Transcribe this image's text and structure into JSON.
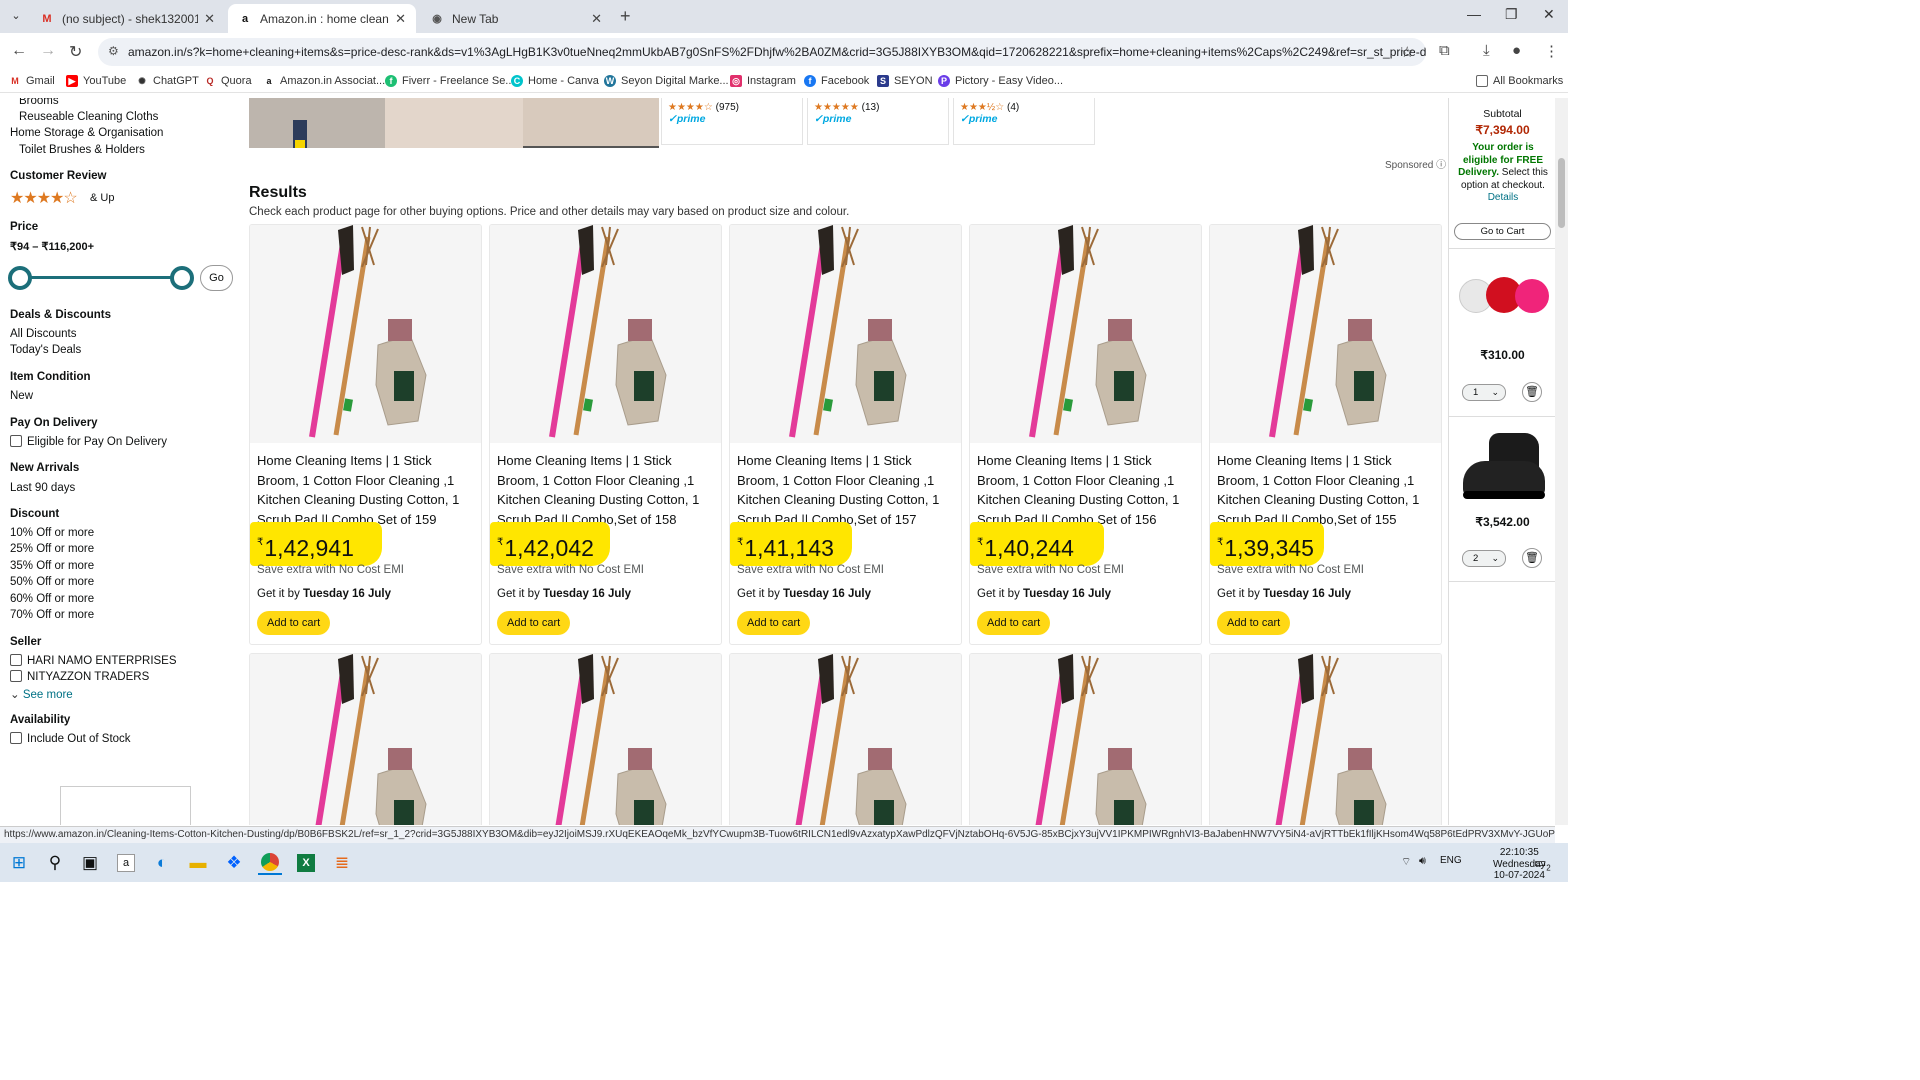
{
  "browser": {
    "tabs": [
      {
        "title": "(no subject) - shek132001@gmail.com",
        "icon": "gmail-icon"
      },
      {
        "title": "Amazon.in : home cleaning items",
        "icon": "amazon-icon"
      },
      {
        "title": "New Tab",
        "icon": "chrome-icon"
      }
    ],
    "url": "amazon.in/s?k=home+cleaning+items&s=price-desc-rank&ds=v1%3AgLHgB1K3v0tueNneq2mmUkbAB7g0SnFS%2FDhjfw%2BA0ZM&crid=3G5J88IXYB3OM&qid=1720628221&sprefix=home+cleaning+items%2Caps%2C249&ref=sr_st_price-desc-ra...",
    "bookmarks": [
      "Gmail",
      "YouTube",
      "ChatGPT",
      "Quora",
      "Amazon.in Associat...",
      "Fiverr - Freelance Se...",
      "Home - Canva",
      "Seyon Digital Marke...",
      "Instagram",
      "Facebook",
      "SEYON",
      "Pictory - Easy Video..."
    ],
    "all_bookmarks": "All Bookmarks",
    "status_url": "https://www.amazon.in/Cleaning-Items-Cotton-Kitchen-Dusting/dp/B0B6FBSK2L/ref=sr_1_2?crid=3G5J88IXYB3OM&dib=eyJ2IjoiMSJ9.rXUqEKEAOqeMk_bzVfYCwupm3B-Tuow6tRILCN1edl9vAzxatypXawPdlzQFVjNztabOHq-6V5JG-85xBCjxY3ujVV1IPKMPIWRgnhVI3-BaJabenHNW7VY5iN4-aVjRTTbEk1fIljKHsom4Wq58P6tEdPRV3XMvY-JGUoPNM_Jm-TTt2l..."
  },
  "sidebar": {
    "top_items": [
      "Brooms",
      "Reuseable Cleaning Cloths",
      "Home Storage & Organisation",
      "Toilet Brushes & Holders"
    ],
    "customer_review": {
      "heading": "Customer Review",
      "stars": 4,
      "suffix": "& Up"
    },
    "price": {
      "heading": "Price",
      "range": "₹94 – ₹116,200+",
      "go": "Go",
      "min_fraction": 0,
      "max_fraction": 1
    },
    "deals": {
      "heading": "Deals & Discounts",
      "items": [
        "All Discounts",
        "Today's Deals"
      ]
    },
    "condition": {
      "heading": "Item Condition",
      "items": [
        "New"
      ]
    },
    "pod": {
      "heading": "Pay On Delivery",
      "items": [
        "Eligible for Pay On Delivery"
      ]
    },
    "arrivals": {
      "heading": "New Arrivals",
      "items": [
        "Last 90 days"
      ]
    },
    "discount": {
      "heading": "Discount",
      "items": [
        "10% Off or more",
        "25% Off or more",
        "35% Off or more",
        "50% Off or more",
        "60% Off or more",
        "70% Off or more"
      ]
    },
    "seller": {
      "heading": "Seller",
      "items": [
        "HARI NAMO ENTERPRISES",
        "NITYAZZON TRADERS"
      ],
      "see_more": "See more"
    },
    "availability": {
      "heading": "Availability",
      "items": [
        "Include Out of Stock"
      ]
    }
  },
  "sponsored_strip": {
    "cards": [
      {
        "rating_count": "(975)",
        "prime": "prime"
      },
      {
        "rating_count": "(13)",
        "prime": "prime"
      },
      {
        "rating_count": "(4)",
        "prime": "prime"
      }
    ],
    "sponsored_label": "Sponsored"
  },
  "results": {
    "heading": "Results",
    "subheading": "Check each product page for other buying options. Price and other details may vary based on product size and colour.",
    "products": [
      {
        "title": "Home Cleaning Items | 1 Stick Broom, 1 Cotton Floor Cleaning ,1 Kitchen Cleaning Dusting Cotton, 1 Scrub Pad || Combo,Set of 159",
        "currency": "₹",
        "price": "1,42,941",
        "emi": "Save extra with No Cost EMI",
        "delivery_prefix": "Get it by",
        "delivery_date": "Tuesday 16 July",
        "cta": "Add to cart"
      },
      {
        "title": "Home Cleaning Items | 1 Stick Broom, 1 Cotton Floor Cleaning ,1 Kitchen Cleaning Dusting Cotton, 1 Scrub Pad || Combo,Set of 158",
        "currency": "₹",
        "price": "1,42,042",
        "emi": "Save extra with No Cost EMI",
        "delivery_prefix": "Get it by",
        "delivery_date": "Tuesday 16 July",
        "cta": "Add to cart"
      },
      {
        "title": "Home Cleaning Items | 1 Stick Broom, 1 Cotton Floor Cleaning ,1 Kitchen Cleaning Dusting Cotton, 1 Scrub Pad || Combo,Set of 157",
        "currency": "₹",
        "price": "1,41,143",
        "emi": "Save extra with No Cost EMI",
        "delivery_prefix": "Get it by",
        "delivery_date": "Tuesday 16 July",
        "cta": "Add to cart"
      },
      {
        "title": "Home Cleaning Items | 1 Stick Broom, 1 Cotton Floor Cleaning ,1 Kitchen Cleaning Dusting Cotton, 1 Scrub Pad || Combo,Set of 156",
        "currency": "₹",
        "price": "1,40,244",
        "emi": "Save extra with No Cost EMI",
        "delivery_prefix": "Get it by",
        "delivery_date": "Tuesday 16 July",
        "cta": "Add to cart"
      },
      {
        "title": "Home Cleaning Items | 1 Stick Broom, 1 Cotton Floor Cleaning ,1 Kitchen Cleaning Dusting Cotton, 1 Scrub Pad || Combo,Set of 155",
        "currency": "₹",
        "price": "1,39,345",
        "emi": "Save extra with No Cost EMI",
        "delivery_prefix": "Get it by",
        "delivery_date": "Tuesday 16 July",
        "cta": "Add to cart"
      }
    ]
  },
  "cart_rail": {
    "subtotal_label": "Subtotal",
    "subtotal": "₹7,394.00",
    "free_bold": "Your order is eligible for FREE Delivery.",
    "free_rest": "Select this option at checkout.",
    "details": "Details",
    "go_to_cart": "Go to Cart",
    "items": [
      {
        "price": "₹310.00",
        "qty": "1",
        "image": "cricket-balls"
      },
      {
        "price": "₹3,542.00",
        "qty": "2",
        "image": "black-boot"
      }
    ]
  },
  "taskbar": {
    "lang": "ENG",
    "time": "22:10:35",
    "day": "Wednesday",
    "date": "10-07-2024",
    "notifications": "2"
  },
  "colors": {
    "highlight": "#ffe600",
    "add_to_cart": "#ffd814",
    "price_red": "#b12704",
    "star": "#de7921",
    "slider": "#1c6f7a"
  }
}
